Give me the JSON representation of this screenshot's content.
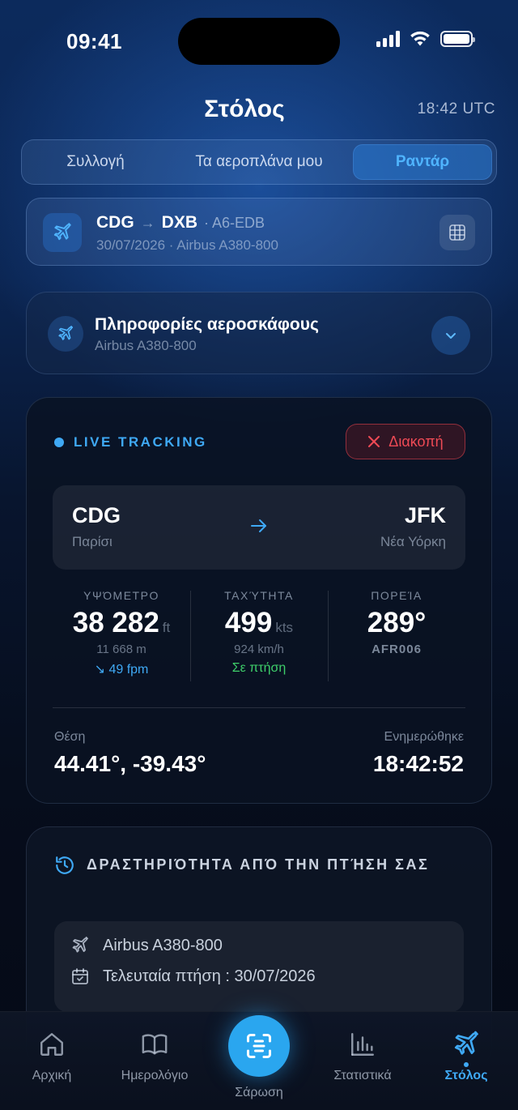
{
  "status_bar": {
    "time": "09:41"
  },
  "header": {
    "title": "Στόλος",
    "utc_time": "18:42 UTC"
  },
  "segments": [
    {
      "label": "Συλλογή",
      "active": false
    },
    {
      "label": "Τα αεροπλάνα μου",
      "active": false
    },
    {
      "label": "Ραντάρ",
      "active": true
    }
  ],
  "flight_card": {
    "origin": "CDG",
    "arrow": "→",
    "destination": "DXB",
    "registration": "· A6-EDB",
    "meta": "30/07/2026 · Airbus A380-800",
    "icon": "plane-icon"
  },
  "aircraft_info": {
    "title": "Πληροφορίες αεροσκάφους",
    "subtitle": "Airbus A380-800"
  },
  "live_tracking": {
    "label": "LIVE TRACKING",
    "stop_label": "Διακοπή",
    "origin_code": "CDG",
    "origin_city": "Παρίσι",
    "dest_code": "JFK",
    "dest_city": "Νέα Υόρκη",
    "altitude": {
      "label": "ΥΨΌΜΕΤΡΟ",
      "value": "38 282",
      "unit": "ft",
      "sub": "11 668 m",
      "extra": "↘ 49 fpm"
    },
    "speed": {
      "label": "ΤΑΧΎΤΗΤΑ",
      "value": "499",
      "unit": "kts",
      "sub": "924 km/h",
      "extra": "Σε πτήση"
    },
    "heading": {
      "label": "ΠΟΡΕΊΑ",
      "value": "289°",
      "sub": "AFR006"
    },
    "position_label": "Θέση",
    "position_value": "44.41°, -39.43°",
    "updated_label": "Ενημερώθηκε",
    "updated_value": "18:42:52"
  },
  "activity": {
    "title": "ΔΡΑΣΤΗΡΙΌΤΗΤΑ ΑΠΌ ΤΗΝ ΠΤΉΣΗ ΣΑΣ",
    "aircraft": "Airbus A380-800",
    "last_flight": "Τελευταία πτήση : 30/07/2026"
  },
  "tabs": [
    {
      "label": "Αρχική",
      "icon": "home-icon"
    },
    {
      "label": "Ημερολόγιο",
      "icon": "book-icon"
    },
    {
      "label": "Σάρωση",
      "icon": "scan-icon"
    },
    {
      "label": "Στατιστικά",
      "icon": "chart-icon"
    },
    {
      "label": "Στόλος",
      "icon": "plane-icon",
      "active": true
    }
  ],
  "colors": {
    "accent": "#3fa9f5",
    "stop": "#ee4a55",
    "in_flight": "#3ecf6a"
  }
}
